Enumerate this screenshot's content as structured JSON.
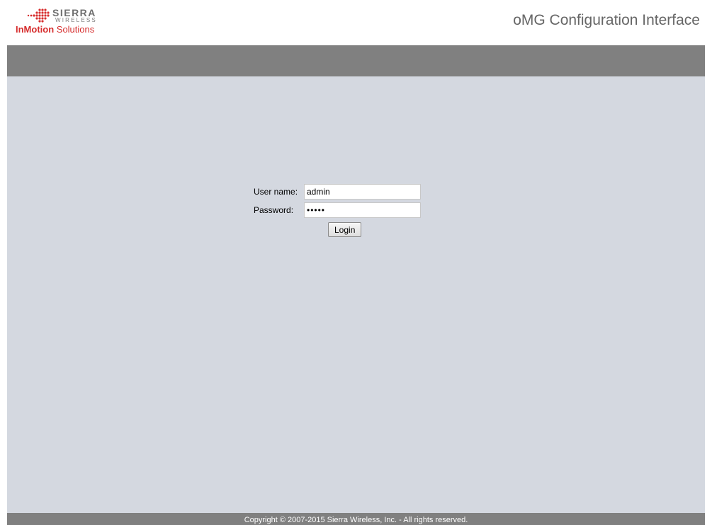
{
  "header": {
    "logo": {
      "brand": "SIERRA",
      "brand_sub": "WIRELESS",
      "tagline_bold": "InMotion",
      "tagline_rest": " Solutions",
      "icon": "sierra-wireless-logo-icon"
    },
    "title": "oMG Configuration Interface"
  },
  "login": {
    "username_label": "User name:",
    "username_value": "admin",
    "password_label": "Password:",
    "password_value": "admin",
    "login_button": "Login"
  },
  "footer": {
    "copyright": "Copyright © 2007-2015 Sierra Wireless, Inc. - All rights reserved."
  },
  "colors": {
    "bar": "#808080",
    "content_bg": "#d4d8e0",
    "brand_red": "#d62d2d",
    "title_gray": "#666666"
  }
}
